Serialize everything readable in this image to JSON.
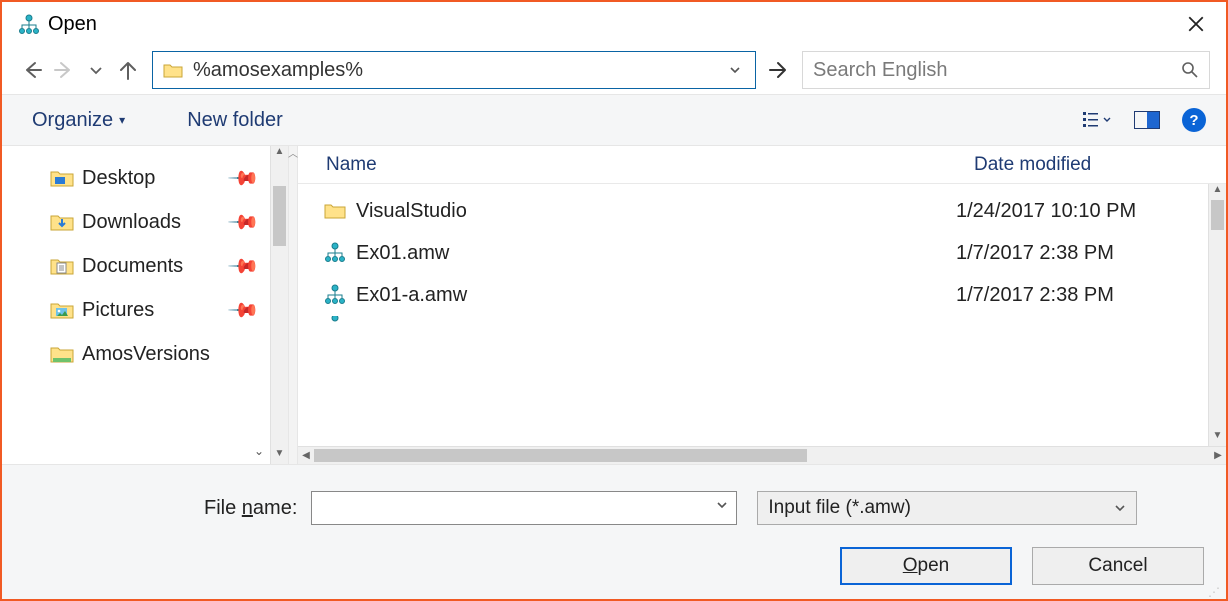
{
  "window": {
    "title": "Open"
  },
  "nav": {
    "address": "%amosexamples%",
    "search_placeholder": "Search English"
  },
  "toolbar": {
    "organize": "Organize",
    "newfolder": "New folder"
  },
  "tree": {
    "items": [
      {
        "label": "Desktop",
        "pinned": true,
        "kind": "desktop"
      },
      {
        "label": "Downloads",
        "pinned": true,
        "kind": "downloads"
      },
      {
        "label": "Documents",
        "pinned": true,
        "kind": "documents"
      },
      {
        "label": "Pictures",
        "pinned": true,
        "kind": "pictures"
      },
      {
        "label": "AmosVersions",
        "pinned": false,
        "kind": "folder"
      }
    ]
  },
  "list": {
    "columns": {
      "name": "Name",
      "date": "Date modified"
    },
    "rows": [
      {
        "name": "VisualStudio",
        "date": "1/24/2017 10:10 PM",
        "kind": "folder"
      },
      {
        "name": "Ex01.amw",
        "date": "1/7/2017 2:38 PM",
        "kind": "amw"
      },
      {
        "name": "Ex01-a.amw",
        "date": "1/7/2017 2:38 PM",
        "kind": "amw"
      }
    ]
  },
  "footer": {
    "filename_label_pre": "File ",
    "filename_label_u": "n",
    "filename_label_post": "ame:",
    "filetype": "Input file (*.amw)",
    "open_u": "O",
    "open_post": "pen",
    "cancel": "Cancel"
  }
}
